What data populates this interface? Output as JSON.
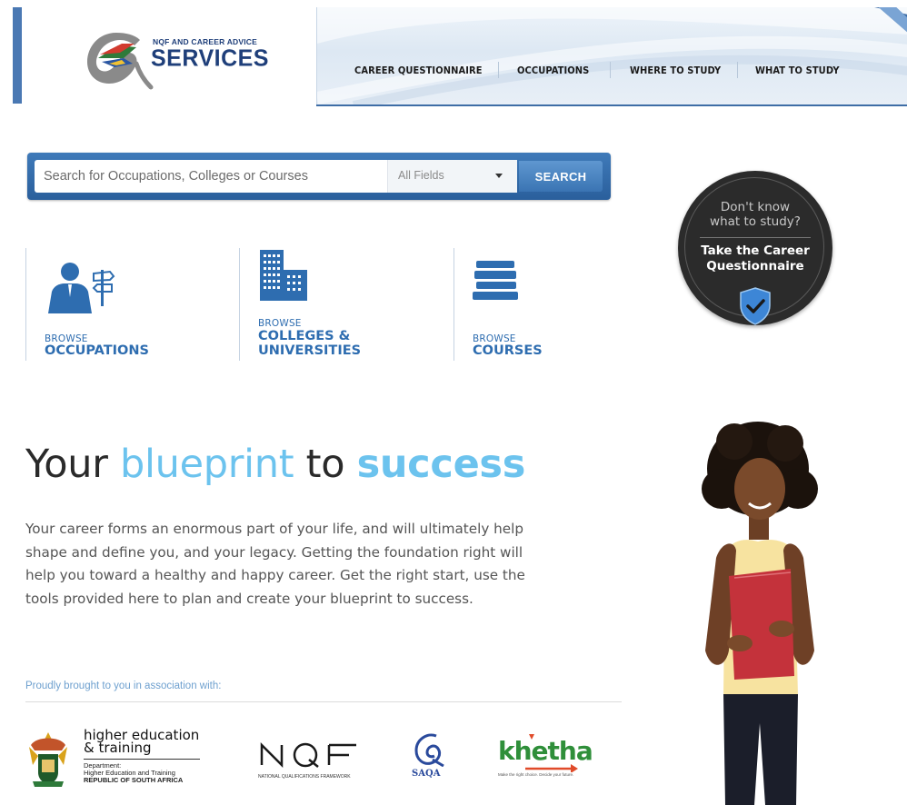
{
  "header": {
    "logo_small": "NQF AND CAREER ADVICE",
    "logo_big": "SERVICES",
    "nav": [
      {
        "label": "CAREER QUESTIONNAIRE"
      },
      {
        "label": "OCCUPATIONS"
      },
      {
        "label": "WHERE TO STUDY"
      },
      {
        "label": "WHAT TO STUDY"
      }
    ]
  },
  "search": {
    "placeholder": "Search for Occupations, Colleges or Courses",
    "fields_selected": "All Fields",
    "button_label": "SEARCH"
  },
  "browse": [
    {
      "small": "BROWSE",
      "big_lines": [
        "OCCUPATIONS"
      ],
      "icon": "person-signpost-icon"
    },
    {
      "small": "BROWSE",
      "big_lines": [
        "COLLEGES &",
        "UNIVERSITIES"
      ],
      "icon": "buildings-icon"
    },
    {
      "small": "BROWSE",
      "big_lines": [
        "COURSES"
      ],
      "icon": "books-icon"
    }
  ],
  "badge": {
    "line1": "Don't know",
    "line2": "what to study?",
    "line3": "Take the Career",
    "line4": "Questionnaire",
    "icon": "shield-check-icon"
  },
  "hero": {
    "headline_part1": "Your ",
    "headline_part2": "blueprint",
    "headline_part3": " to ",
    "headline_part4": "success",
    "intro": "Your career forms an enormous part of your life, and will ultimately help shape and define you, and your legacy. Getting the foundation right will help you toward a healthy and happy career. Get the right start, use the tools provided here to plan and create your blueprint to success."
  },
  "partners": {
    "intro": "Proudly brought to you in association with:",
    "dhet_title_1": "higher education",
    "dhet_title_2": "& training",
    "dhet_sub_1": "Department:",
    "dhet_sub_2": "Higher Education and Training",
    "dhet_sub_3": "REPUBLIC OF SOUTH AFRICA",
    "nqf_logo": "NQF",
    "nqf_sub": "NATIONAL QUALIFICATIONS FRAMEWORK",
    "saqa_label": "SAQA",
    "khetha_word": "khetha",
    "khetha_tag": "Make the right choice. Decide your future."
  },
  "colors": {
    "brand_blue": "#2e6db0",
    "headline_light_blue": "#6cc3ee",
    "nav_dark_blue": "#3e6da6",
    "badge_dark": "#2b2b2b"
  }
}
